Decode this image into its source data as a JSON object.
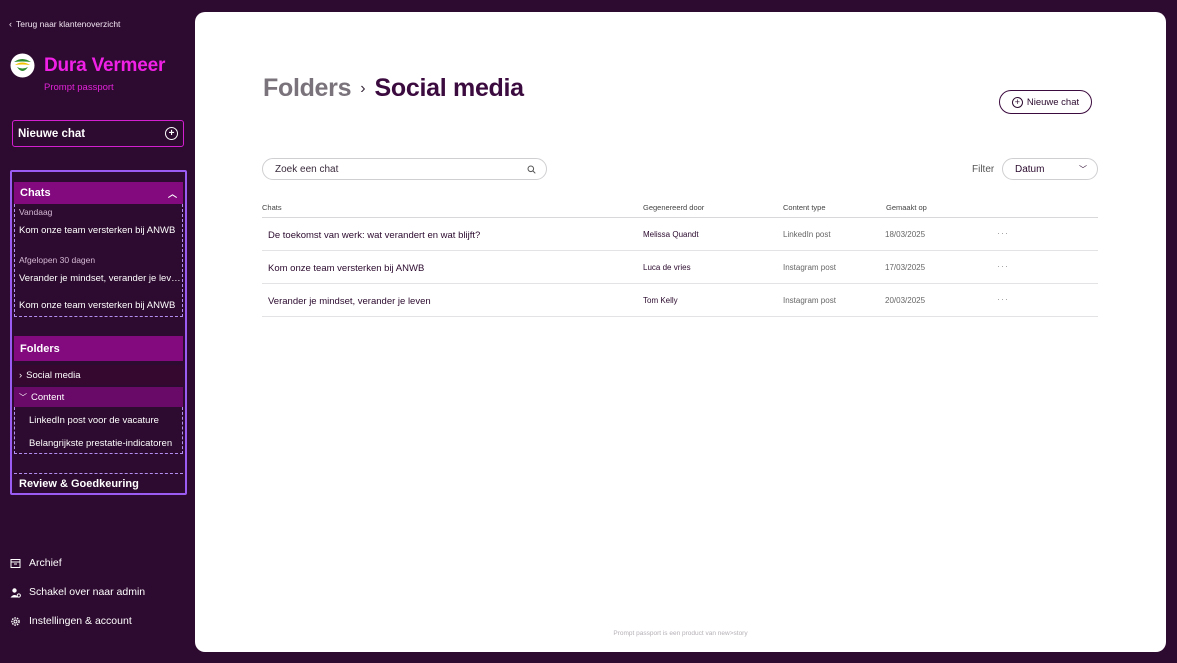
{
  "sidebar": {
    "back_label": "Terug naar klantenoverzicht",
    "brand_name": "Dura Vermeer",
    "brand_sub": "Prompt passport",
    "new_chat_label": "Nieuwe chat",
    "chats_header": "Chats",
    "groups": {
      "today_label": "Vandaag",
      "last30_label": "Afgelopen 30 dagen"
    },
    "chats": [
      "Kom onze team versterken bij ANWB",
      "Verander je mindset, verander je leven",
      "Kom onze team versterken bij ANWB"
    ],
    "folders_header": "Folders",
    "folders": [
      {
        "label": "Social media"
      },
      {
        "label": "Content",
        "items": [
          "LinkedIn post voor de vacature",
          "Belangrijkste prestatie-indicatoren"
        ]
      }
    ],
    "review_header": "Review & Goedkeuring",
    "bottom": {
      "archive": "Archief",
      "switch_admin": "Schakel over naar admin",
      "settings": "Instellingen & account"
    }
  },
  "main": {
    "breadcrumb_folders": "Folders",
    "breadcrumb_current": "Social media",
    "new_chat_label": "Nieuwe chat",
    "search_placeholder": "Zoek een chat",
    "filter_label": "Filter",
    "filter_value": "Datum",
    "columns": [
      "Chats",
      "Gegenereerd door",
      "Content type",
      "Gemaakt op"
    ],
    "rows": [
      {
        "chat": "De toekomst van werk: wat verandert en wat blijft?",
        "by": "Melissa Quandt",
        "type": "LinkedIn post",
        "date": "18/03/2025",
        "more": "···"
      },
      {
        "chat": "Kom onze team versterken bij ANWB",
        "by": "Luca de vries",
        "type": "Instagram post",
        "date": "17/03/2025",
        "more": "···"
      },
      {
        "chat": "Verander je mindset, verander je leven",
        "by": "Tom Kelly",
        "type": "Instagram post",
        "date": "20/03/2025",
        "more": "···"
      }
    ],
    "footer": "Prompt passport is een product van new>story"
  },
  "colors": {
    "sidebar_bg": "#2d0a2f",
    "brand": "#f020e6",
    "section_header": "#820a7e",
    "nav_border": "#9a5cf2",
    "title_dark": "#3b0a3e"
  },
  "icons": [
    "chevron-left-icon",
    "brand-logo-icon",
    "plus-circle-icon",
    "chevron-up-icon",
    "chevron-right-icon",
    "chevron-down-icon",
    "archive-icon",
    "admin-user-icon",
    "gear-icon",
    "search-icon",
    "more-icon"
  ]
}
